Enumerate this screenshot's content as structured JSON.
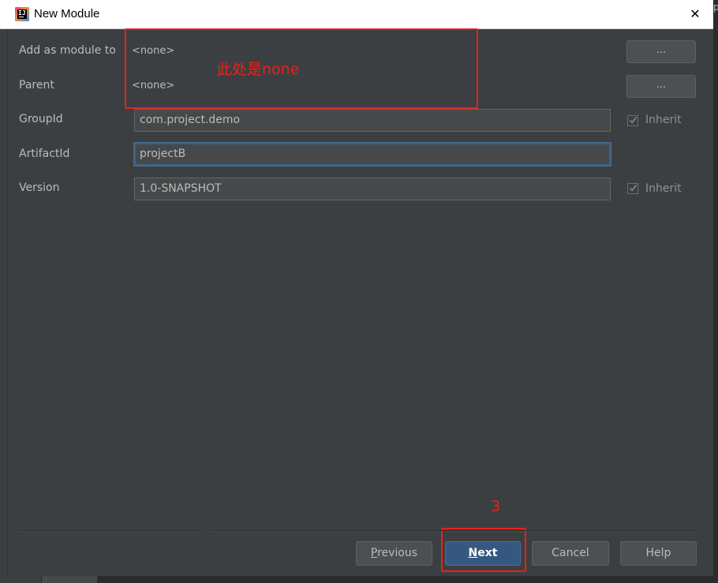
{
  "window": {
    "title": "New Module",
    "close_icon": "close-icon",
    "app_icon": "intellij-idea-icon",
    "app_icon_text": "IJ",
    "edge_fragment": "p"
  },
  "form": {
    "add_as_module_to": {
      "label": "Add as module to",
      "value": "<none>",
      "button": "..."
    },
    "parent": {
      "label": "Parent",
      "value": "<none>",
      "button": "..."
    },
    "group_id": {
      "label": "GroupId",
      "value": "com.project.demo",
      "inherit_label": "Inherit",
      "inherit_checked": true
    },
    "artifact_id": {
      "label": "ArtifactId",
      "value": "projectB"
    },
    "version": {
      "label": "Version",
      "value": "1.0-SNAPSHOT",
      "inherit_label": "Inherit",
      "inherit_checked": true
    }
  },
  "annotations": {
    "note_text": "此处是none",
    "step_number": "3",
    "color": "#e8211c"
  },
  "buttons": {
    "previous": {
      "mnemonic": "P",
      "rest": "revious"
    },
    "next": {
      "mnemonic": "N",
      "rest": "ext"
    },
    "cancel": "Cancel",
    "help": "Help"
  },
  "colors": {
    "dialog_bg": "#3c3f41",
    "field_bg": "#45494a",
    "primary_button": "#365880",
    "focus_border": "#3d6185"
  }
}
